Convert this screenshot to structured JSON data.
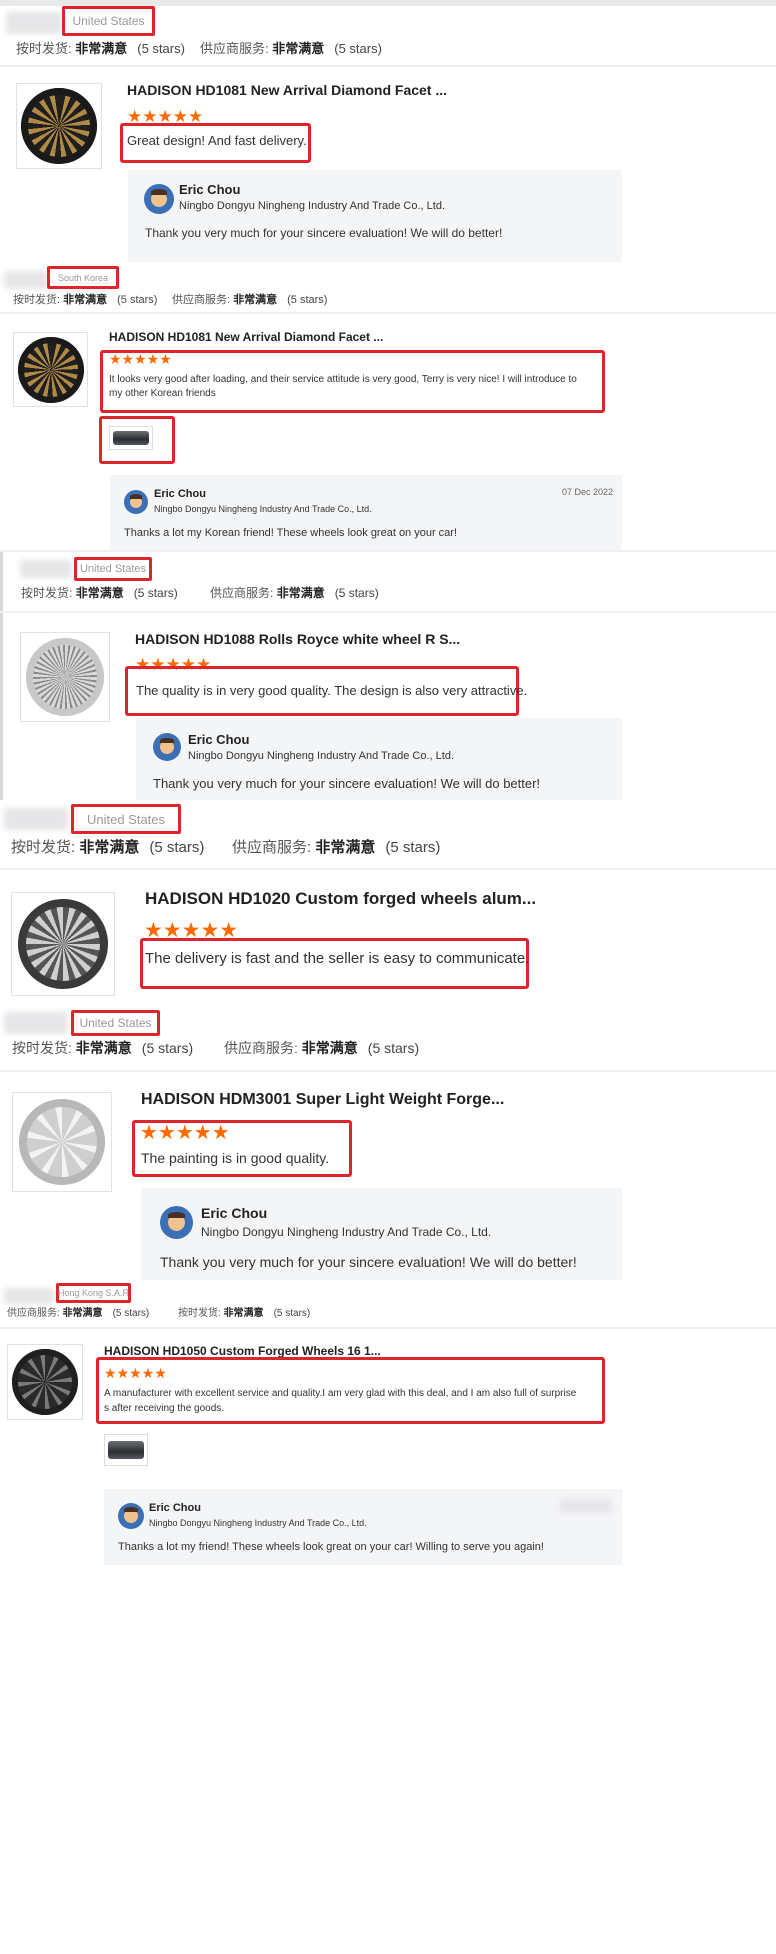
{
  "labels": {
    "on_time": "按时发货:",
    "supplier": "供应商服务:"
  },
  "reviews": [
    {
      "country": "United States",
      "on_time_rating": "非常满意",
      "on_time_stars": "(5 stars)",
      "supplier_rating": "非常满意",
      "supplier_stars": "(5 stars)",
      "product_title": "HADISON HD1081 New Arrival Diamond Facet ...",
      "stars": 5,
      "text": "Great design! And fast delivery.",
      "reply": {
        "name": "Eric Chou",
        "company": "Ningbo Dongyu Ningheng Industry And Trade Co., Ltd.",
        "text": "Thank you very much for your sincere evaluation! We will do better!"
      }
    },
    {
      "country": "South Korea",
      "on_time_rating": "非常满意",
      "on_time_stars": "(5 stars)",
      "supplier_rating": "非常满意",
      "supplier_stars": "(5 stars)",
      "product_title": "HADISON HD1081 New Arrival Diamond Facet ...",
      "stars": 5,
      "text_lines": [
        "It looks very good after loading, and their service attitude is very good, Terry is very nice!  I will introduce to",
        "my other Korean friends"
      ],
      "reply": {
        "name": "Eric Chou",
        "company": "Ningbo Dongyu Ningheng Industry And Trade Co., Ltd.",
        "date": "07 Dec 2022",
        "text": "Thanks a lot my Korean friend!  These wheels look great on your car!"
      }
    },
    {
      "country": "United States",
      "on_time_rating": "非常满意",
      "on_time_stars": "(5 stars)",
      "supplier_rating": "非常满意",
      "supplier_stars": "(5 stars)",
      "product_title": "HADISON HD1088 Rolls Royce white wheel R S...",
      "stars": 5,
      "text": "The quality is in very good quality. The design is also very attractive.",
      "reply": {
        "name": "Eric Chou",
        "company": "Ningbo Dongyu Ningheng Industry And Trade Co., Ltd.",
        "text": "Thank you very much for your sincere evaluation! We will do better!"
      }
    },
    {
      "country": "United States",
      "on_time_rating": "非常满意",
      "on_time_stars": "(5 stars)",
      "supplier_rating": "非常满意",
      "supplier_stars": "(5 stars)",
      "product_title": "HADISON HD1020 Custom forged wheels alum...",
      "stars": 5,
      "text": "The delivery is fast and the seller is easy to communicate."
    },
    {
      "country": "United States",
      "on_time_rating": "非常满意",
      "on_time_stars": "(5 stars)",
      "supplier_rating": "非常满意",
      "supplier_stars": "(5 stars)",
      "product_title": "HADISON HDM3001 Super Light Weight Forge...",
      "stars": 5,
      "text": "The painting is in good quality.",
      "reply": {
        "name": "Eric Chou",
        "company": "Ningbo Dongyu Ningheng Industry And Trade Co., Ltd.",
        "text": "Thank you very much for your sincere evaluation! We will do better!"
      }
    },
    {
      "country": "Hong Kong S.A.R",
      "on_time_rating": "非常满意",
      "on_time_stars": "(5 stars)",
      "supplier_rating": "非常满意",
      "supplier_stars": "(5 stars)",
      "product_title": "HADISON HD1050 Custom Forged Wheels 16 1...",
      "stars": 5,
      "text_lines": [
        "A manufacturer with excellent service and quality.I am very glad with this deal, and I am also full of surprise",
        "s after receiving the goods."
      ],
      "reply": {
        "name": "Eric Chou",
        "company": "Ningbo Dongyu Ningheng Industry And Trade Co., Ltd.",
        "text": "Thanks a lot my friend!  These wheels look great on your car! Willing to serve you again!"
      }
    }
  ],
  "colors": {
    "star": "#ff6a00",
    "highlight": "#e0242b",
    "reply_bg": "#f4f5f7"
  },
  "icons": {
    "star": "star-icon",
    "avatar": "avatar-icon"
  }
}
